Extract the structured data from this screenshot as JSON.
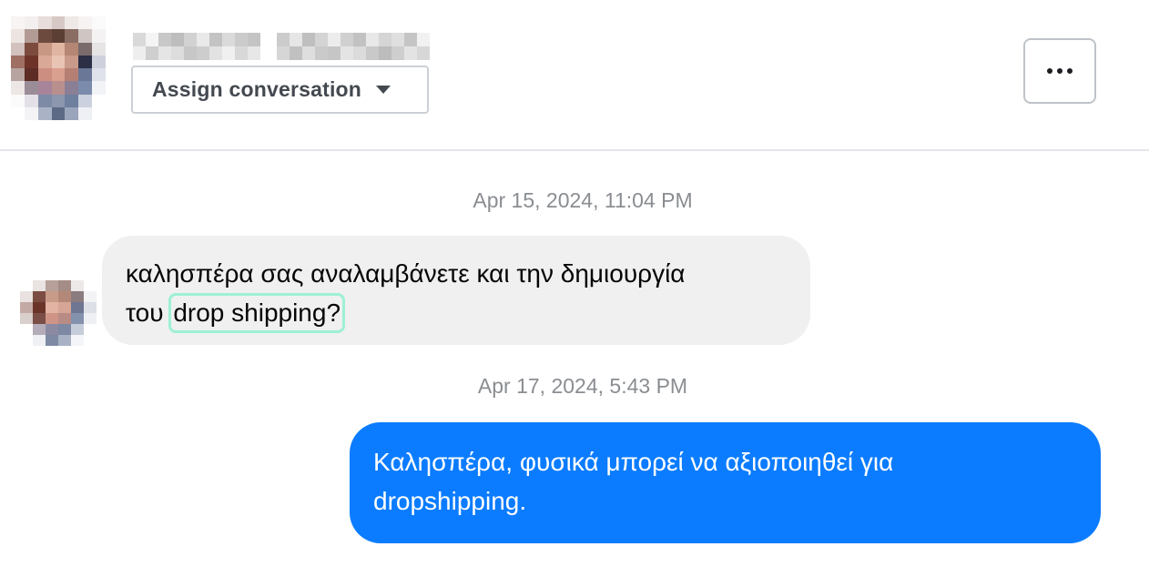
{
  "header": {
    "assign_label": "Assign conversation",
    "more_button_icon": "more-horizontal-icon",
    "caret_icon": "caret-down-icon"
  },
  "messages": [
    {
      "timestamp": "Apr 15, 2024, 11:04 PM",
      "direction": "incoming",
      "line1": "καλησπέρα σας αναλαμβάνετε και την δημιουργία",
      "line2_prefix": "του ",
      "line2_highlight": "drop shipping?"
    },
    {
      "timestamp": "Apr 17, 2024, 5:43 PM",
      "direction": "outgoing",
      "line1": "Καλησπέρα, φυσικά μπορεί να αξιοποιηθεί για",
      "line2": "dropshipping."
    }
  ],
  "colors": {
    "outgoing_bubble": "#0b7cff",
    "incoming_bubble": "#f0f0f0",
    "highlight_border": "#9ef0d6",
    "timestamp": "#8a8d91"
  }
}
